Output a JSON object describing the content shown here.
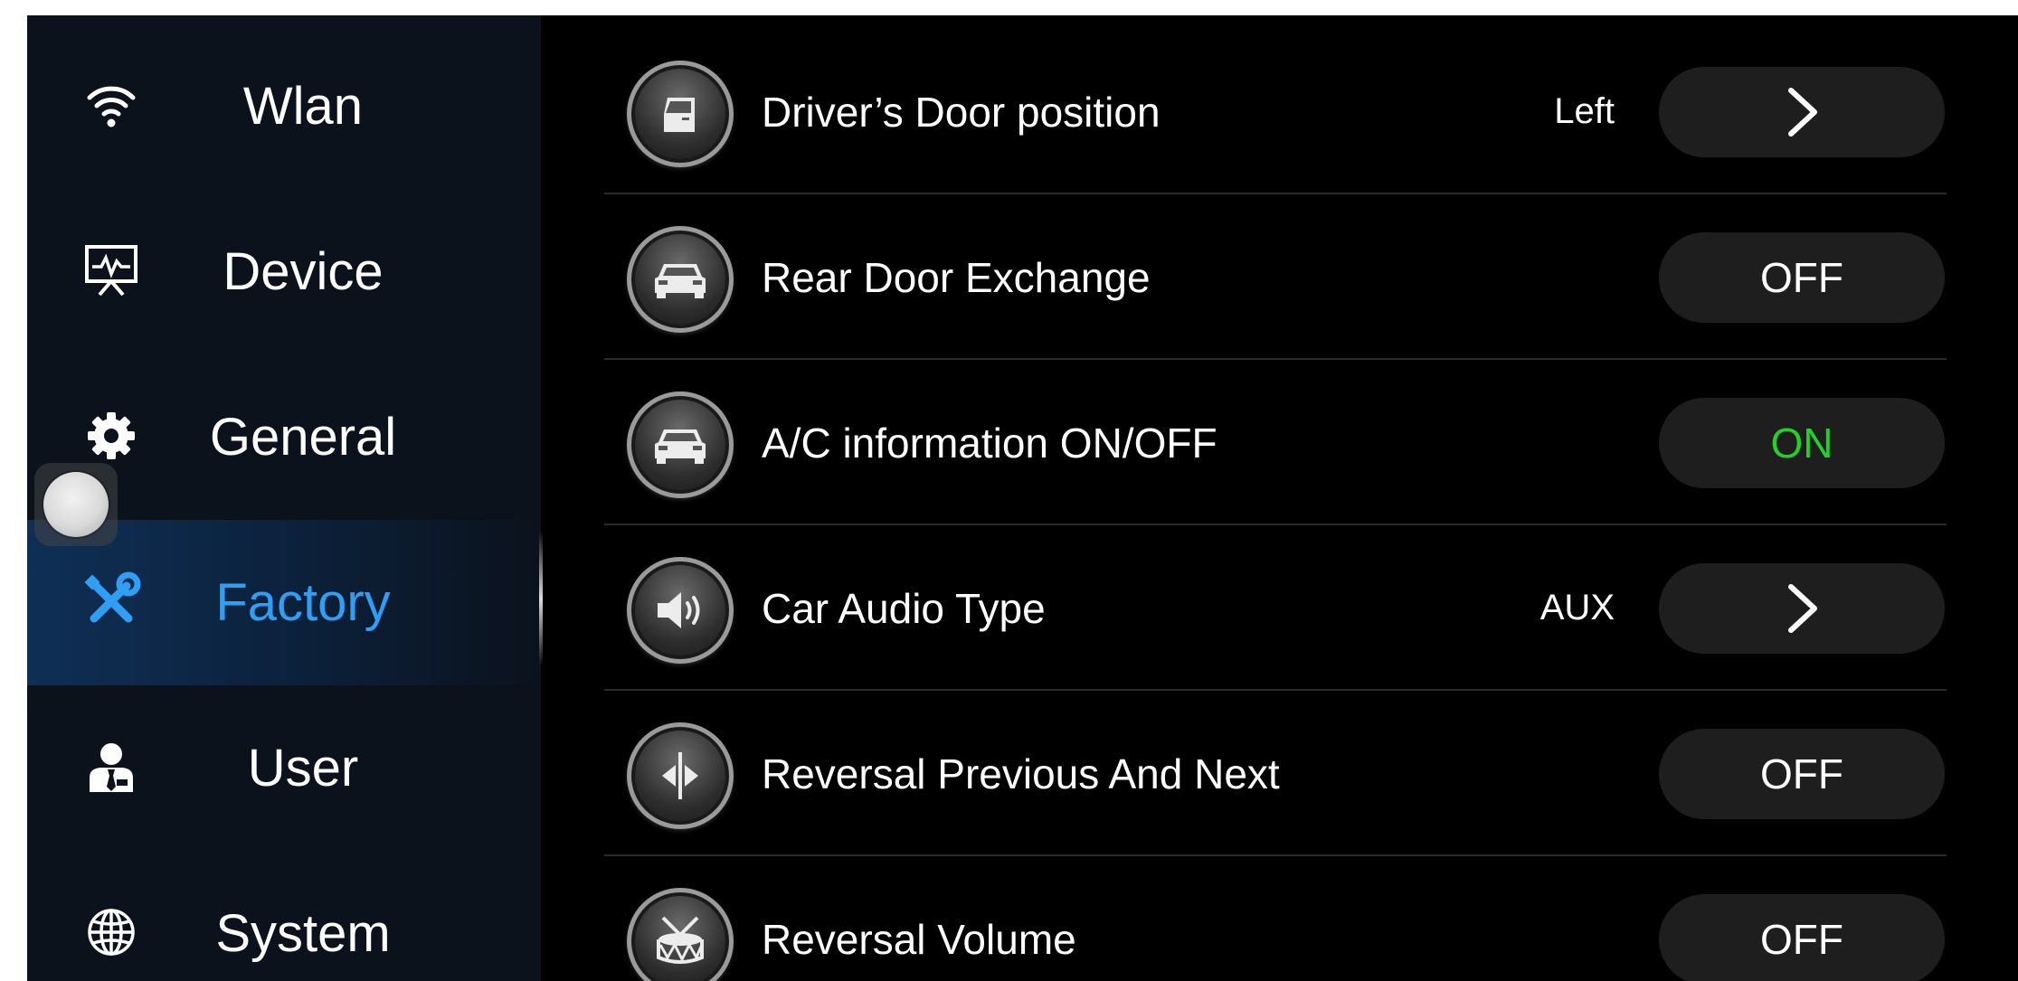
{
  "sidebar": {
    "items": [
      {
        "label": "Wlan",
        "icon": "wifi-icon"
      },
      {
        "label": "Device",
        "icon": "device-monitor-icon"
      },
      {
        "label": "General",
        "icon": "gear-icon"
      },
      {
        "label": "Factory",
        "icon": "wrench-screwdriver-icon",
        "active": true
      },
      {
        "label": "User",
        "icon": "user-icon"
      },
      {
        "label": "System",
        "icon": "globe-icon"
      }
    ]
  },
  "settings": {
    "rows": [
      {
        "label": "Driver’s Door position",
        "value": "Left",
        "control": ">",
        "icon": "door-icon"
      },
      {
        "label": "Rear Door Exchange",
        "value": "",
        "control": "OFF",
        "icon": "car-icon"
      },
      {
        "label": "A/C information ON/OFF",
        "value": "",
        "control": "ON",
        "icon": "car-icon"
      },
      {
        "label": "Car Audio Type",
        "value": "AUX",
        "control": ">",
        "icon": "speaker-icon"
      },
      {
        "label": "Reversal Previous And Next",
        "value": "",
        "control": "OFF",
        "icon": "prev-next-icon"
      },
      {
        "label": "Reversal Volume",
        "value": "",
        "control": "OFF",
        "icon": "drum-icon"
      }
    ]
  },
  "colors": {
    "accent": "#2f9ff5",
    "on": "#22d12a",
    "sidebar_bg": "#0b121c",
    "background": "#000000"
  }
}
